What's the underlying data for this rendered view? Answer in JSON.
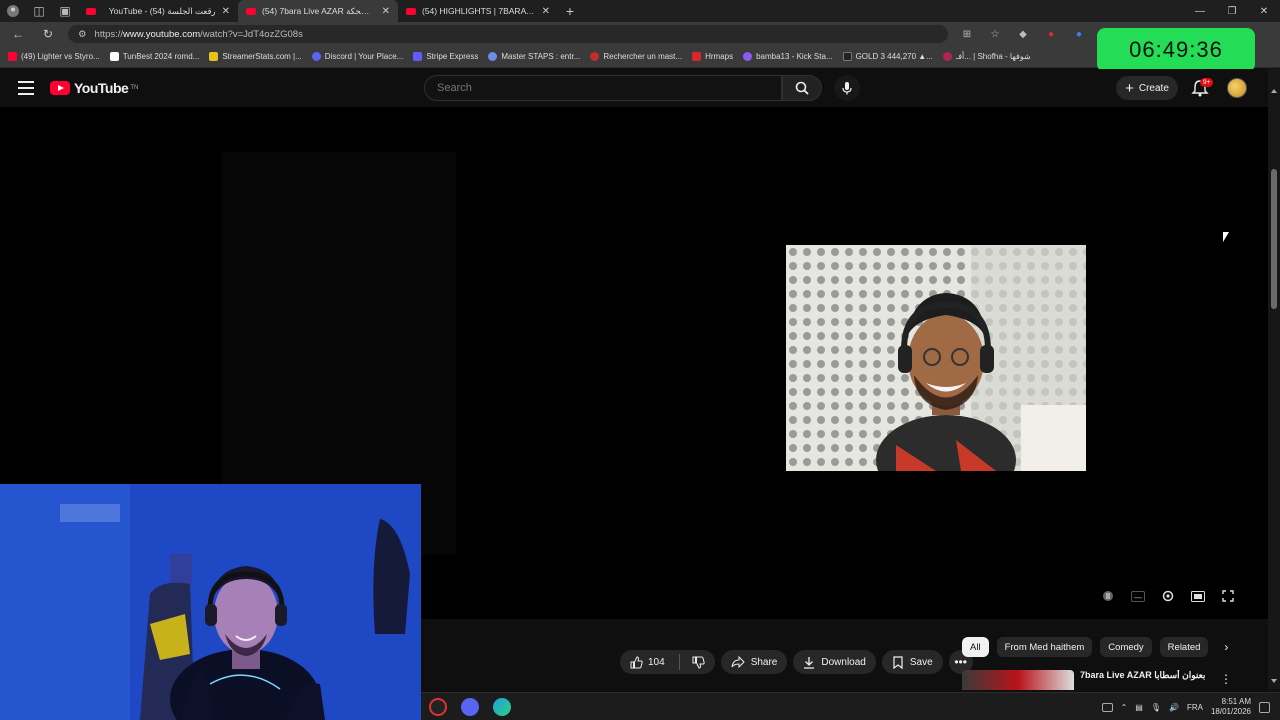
{
  "browser": {
    "tabs": [
      {
        "title": "YouTube - رقعت الجلسة (54)",
        "active": false
      },
      {
        "title": "(54) 7bara Live AZAR لقطات مضحكة",
        "active": true
      },
      {
        "title": "(54) HIGHLIGHTS | 7BARA - BN...",
        "active": false
      }
    ],
    "url_prefix": "https://",
    "url_host": "www.youtube.com",
    "url_path": "/watch?v=JdT4ozZG08s"
  },
  "bookmarks": [
    {
      "label": "(49) Lighter vs Styro...",
      "color": "#ff0033"
    },
    {
      "label": "TunBest 2024 romd...",
      "color": "#ffffff"
    },
    {
      "label": "StreamerStats.com |...",
      "color": "#e8c21a"
    },
    {
      "label": "Discord | Your Place...",
      "color": "#5865f2"
    },
    {
      "label": "Stripe Express",
      "color": "#635bff"
    },
    {
      "label": "Master STAPS : entr...",
      "color": "#6a8ee8"
    },
    {
      "label": "Rechercher un mast...",
      "color": "#c42b2b"
    },
    {
      "label": "Hrmaps",
      "color": "#d9272e"
    },
    {
      "label": "bamba13 - Kick Sta...",
      "color": "#8a5cf6"
    },
    {
      "label": "GOLD 3 444,270 ▲...",
      "color": "#222222"
    },
    {
      "label": "أفـ... | Shofha - شوفها",
      "color": "#b2264e"
    }
  ],
  "clock": "06:49:36",
  "youtube": {
    "logo_text": "YouTube",
    "logo_country": "TN",
    "search_placeholder": "Search",
    "create_label": "Create",
    "notif_badge": "9+"
  },
  "actions": {
    "like_count": "104",
    "share_label": "Share",
    "download_label": "Download",
    "save_label": "Save"
  },
  "chips": [
    {
      "label": "All",
      "active": true
    },
    {
      "label": "From Med haithem",
      "active": false
    },
    {
      "label": "Comedy",
      "active": false
    },
    {
      "label": "Related",
      "active": false
    }
  ],
  "recommendation": {
    "title": "7bara Live AZAR بعنوان أسطابا"
  },
  "taskbar": {
    "lang": "FRA",
    "time": "8:51 AM",
    "date": "18/01/2026"
  }
}
